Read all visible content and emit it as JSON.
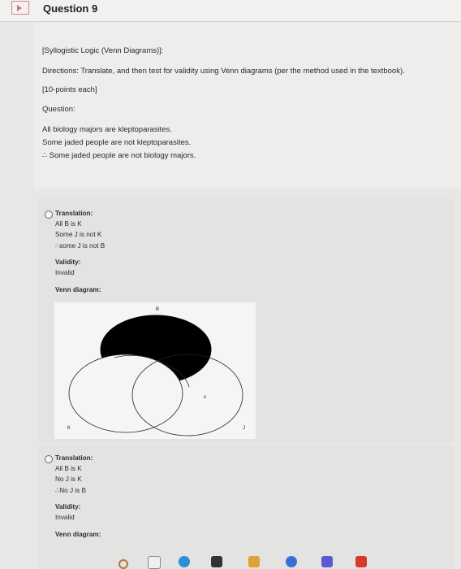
{
  "header": {
    "title": "Question 9"
  },
  "question": {
    "category": "[Syllogistic Logic (Venn Diagrams)]:",
    "directions": "Directions: Translate, and then test for validity using Venn diagrams (per the method used in the textbook).",
    "points": "[10-points each]",
    "label": "Question:",
    "premise1": "All biology majors are kleptoparasites.",
    "premise2": "Some jaded people are not kleptoparasites.",
    "conclusion": "∴ Some jaded people are not biology majors."
  },
  "options": [
    {
      "translation_label": "Translation:",
      "line1": "All B is K",
      "line2": "Some J is not K",
      "line3": "∴some J is not B",
      "validity_label": "Validity:",
      "validity": "Invalid",
      "venn_label": "Venn diagram:",
      "venn": {
        "label_b": "B",
        "label_k": "K",
        "label_j": "J",
        "mark_x": "x"
      }
    },
    {
      "translation_label": "Translation:",
      "line1": "All B is K",
      "line2": "No J is K",
      "line3": "∴No J is B",
      "validity_label": "Validity:",
      "validity": "Invalid",
      "venn_label": "Venn diagram:"
    }
  ],
  "taskbar": {
    "icons": [
      "finder-icon",
      "calendar-icon",
      "chrome-icon",
      "files-icon",
      "notes-icon",
      "store-icon",
      "app-icon",
      "record-icon"
    ],
    "colors": {
      "chrome": "#2e8fd6",
      "notes": "#e0a238",
      "store": "#3b6fd8",
      "app": "#5b5bd0",
      "record": "#d63a2a"
    }
  }
}
